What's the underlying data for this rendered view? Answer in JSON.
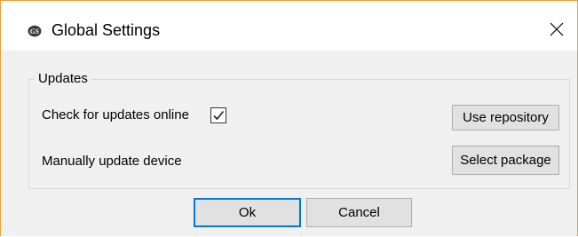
{
  "window": {
    "title": "Global Settings",
    "app_icon": "gs-logo-icon",
    "close_glyph": "✕"
  },
  "updates_group": {
    "legend": "Updates",
    "check_online_label": "Check for updates online",
    "check_online_checked": true,
    "use_repository_label": "Use repository",
    "manual_update_label": "Manually update device",
    "select_package_label": "Select package"
  },
  "footer": {
    "ok_label": "Ok",
    "cancel_label": "Cancel"
  },
  "colors": {
    "accent": "#0078d7",
    "window_border": "#e8a33d"
  }
}
